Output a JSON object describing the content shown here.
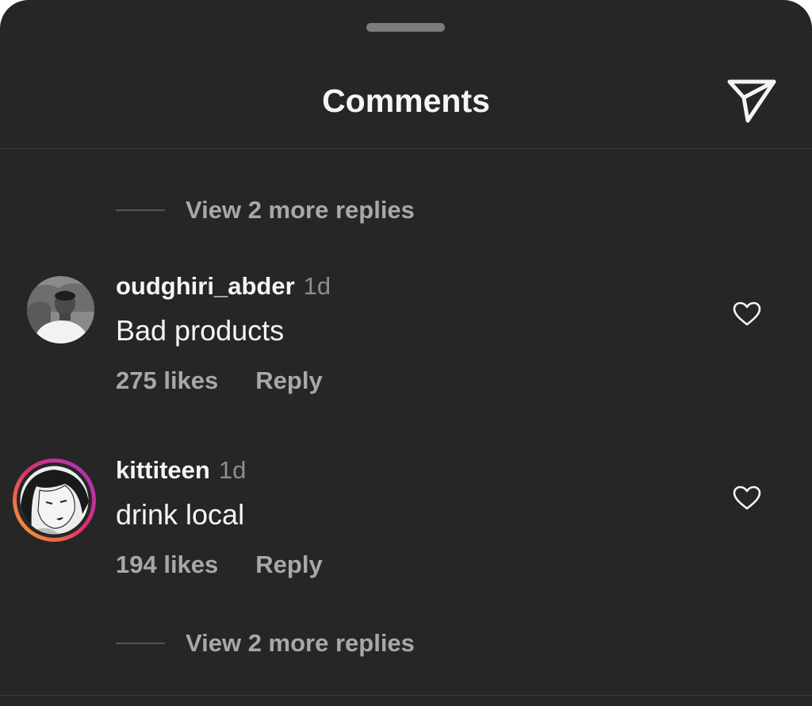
{
  "sheet": {
    "title": "Comments",
    "share_icon": "paper-plane-icon",
    "background": "#262626"
  },
  "view_more_replies_label": "View 2 more replies",
  "comments": [
    {
      "username": "oudghiri_abder",
      "time": "1d",
      "text": "Bad products",
      "likes": "275 likes",
      "reply_label": "Reply",
      "avatar": "user-photo-avatar",
      "has_story_ring": false,
      "like_icon": "heart-outline-icon"
    },
    {
      "username": "kittiteen",
      "time": "1d",
      "text": "drink local",
      "likes": "194 likes",
      "reply_label": "Reply",
      "avatar": "anime-drawing-avatar",
      "has_story_ring": true,
      "like_icon": "heart-outline-icon"
    }
  ],
  "colors": {
    "primary_text": "#f5f5f5",
    "secondary_text": "#a8a8a8",
    "story_ring_start": "#f9a825",
    "story_ring_end": "#c13584"
  }
}
